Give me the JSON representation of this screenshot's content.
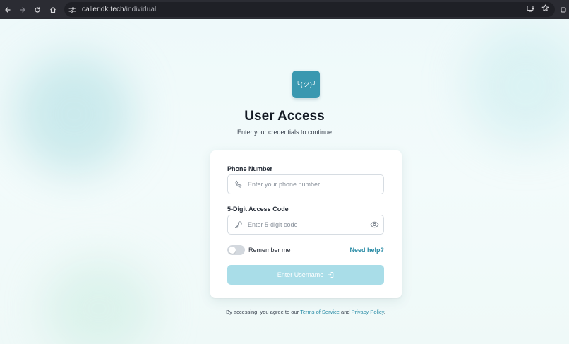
{
  "browser": {
    "url_host": "calleridk.tech",
    "url_path": "/individual"
  },
  "logo": {
    "text": "╰(ツ)╯"
  },
  "header": {
    "title": "User Access",
    "subtitle": "Enter your credentials to continue"
  },
  "form": {
    "phone": {
      "label": "Phone Number",
      "placeholder": "Enter your phone number",
      "value": ""
    },
    "code": {
      "label": "5-Digit Access Code",
      "placeholder": "Enter 5-digit code",
      "value": ""
    },
    "remember": {
      "label": "Remember me",
      "checked": false
    },
    "help_link": "Need help?",
    "submit_label": "Enter Username"
  },
  "footer": {
    "prefix": "By accessing, you agree to our",
    "terms": "Terms of Service",
    "and": "and",
    "privacy": "Privacy Policy",
    "suffix": "."
  },
  "colors": {
    "accent": "#2a8ca6",
    "logo_bg": "#3a98b0",
    "button_disabled": "#a9dde8"
  },
  "icons": {
    "back": "arrow-left-icon",
    "forward": "arrow-right-icon",
    "reload": "reload-icon",
    "home": "home-icon",
    "site_info": "site-settings-icon",
    "install": "install-app-icon",
    "bookmark": "star-icon",
    "phone": "phone-icon",
    "key": "key-icon",
    "eye": "eye-icon",
    "login": "login-icon"
  }
}
